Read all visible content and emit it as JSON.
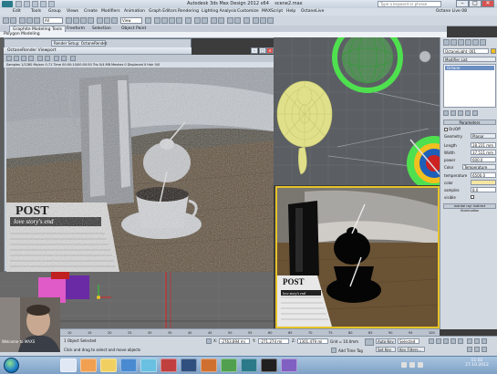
{
  "window": {
    "title": "Autodesk 3ds Max Design 2012 x64",
    "file": "scene2.max",
    "search_placeholder": "Type a keyword or phrase",
    "minimize": "–",
    "maximize": "□",
    "close": "✕"
  },
  "menu": {
    "items": [
      "Edit",
      "Tools",
      "Group",
      "Views",
      "Create",
      "Modifiers",
      "Animation",
      "Graph Editors",
      "Rendering",
      "Lighting Analysis",
      "Customize",
      "MAXScript",
      "Help",
      "OctaneLive"
    ],
    "octane_live": "Octane Live 08"
  },
  "toolbar": {
    "selection_filter": "All",
    "view_dropdown": "View"
  },
  "ribbon": {
    "tabs": [
      "Graphite Modeling Tools",
      "Freeform",
      "Selection",
      "Object Paint"
    ],
    "active_tab": 0,
    "panel_label": "Polygon Modeling"
  },
  "octane": {
    "render_setup_tab": "Render Setup: OctaneRender",
    "title": "OctaneRender Viewport",
    "stats": "Samples 1/1280     Ms/sec 0.71     Time 00:00:10/00:00:50     Tris 0/4 MB     Meshes 0     Displaced 0     Hair 0/0",
    "newspaper_headline": "POST",
    "newspaper_sub": "love story's end"
  },
  "viewport_br": {
    "newspaper_headline": "POST",
    "newspaper_sub": "love story's end"
  },
  "viewport_bl": {
    "tooltip": "Click to open ..."
  },
  "cmdpanel": {
    "object_name": "OctaneLight_001",
    "modifier_list": "Modifier List",
    "stack_item": "Octane",
    "rollout_title": "Parameters",
    "on_off": "On/Off",
    "geometry_label": "Geometry",
    "geometry_value": "Planar",
    "params": [
      {
        "label": "Length",
        "value": "28.231 mm"
      },
      {
        "label": "Width",
        "value": "37.511 mm"
      },
      {
        "label": "power",
        "value": "600.0"
      },
      {
        "label": "Color",
        "value": "Temperature"
      },
      {
        "label": "temperature",
        "value": "6500.0"
      },
      {
        "label": "color",
        "value": ""
      },
      {
        "label": "samples",
        "value": "8.0"
      },
      {
        "label": "visible",
        "value": ""
      }
    ],
    "footer": "mental ray: Indirect Illumination"
  },
  "timeline": {
    "frame": "0 / 100",
    "ticks": [
      "0",
      "5",
      "10",
      "15",
      "20",
      "25",
      "30",
      "35",
      "40",
      "45",
      "50",
      "55",
      "60",
      "65",
      "70",
      "75",
      "80",
      "85",
      "90",
      "95",
      "100"
    ]
  },
  "status": {
    "objects_selected": "1 Object Selected",
    "prompt": "Click and drag to select and move objects",
    "x": "-2763.894 mi",
    "y": "-271.274 mi",
    "z": "1301.479 mi",
    "grid": "Grid = 10.0mm",
    "auto_key": "Auto Key",
    "selected": "Selected",
    "set_key": "Set Key",
    "key_filters": "Key Filters...",
    "add_time_tag": "Add Time Tag",
    "welcome": "Welcome to MAXS"
  },
  "taskbar": {
    "time": "11:02",
    "date": "27.10.2012"
  },
  "colors": {
    "viewport_active": "#e6c32a",
    "teapot_yellow": "#e0e08a",
    "sphere_green": "#4fe04f",
    "accent_blue": "#1e7fc8"
  }
}
